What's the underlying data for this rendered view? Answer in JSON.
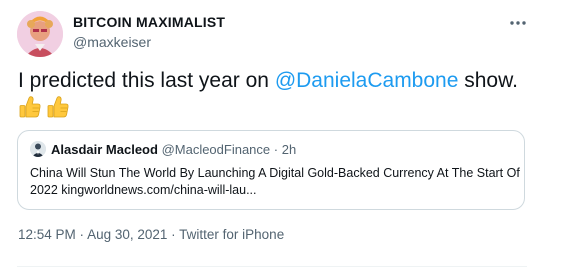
{
  "author": {
    "display_name": "BITCOIN MAXIMALIST",
    "handle": "@maxkeiser",
    "avatar_icon": "profile-avatar-icon"
  },
  "tweet": {
    "text_before": "I predicted this last year on ",
    "mention": "@DanielaCambone",
    "text_after": " show.",
    "emojis": [
      "thumbs-up-icon",
      "thumbs-up-icon"
    ]
  },
  "quote": {
    "author_name": "Alasdair Macleod",
    "author_handle": "@MacleodFinance",
    "separator": " · ",
    "time": "2h",
    "text": "China Will Stun The World By Launching A Digital Gold-Backed Currency At The Start Of 2022  kingworldnews.com/china-will-lau..."
  },
  "meta": {
    "time": "12:54 PM",
    "date": "Aug 30, 2021",
    "separator": " · ",
    "source": "Twitter for iPhone"
  },
  "colors": {
    "link": "#1d9bf0",
    "muted": "#536471",
    "border": "#cfd9de",
    "text": "#0f1419"
  }
}
